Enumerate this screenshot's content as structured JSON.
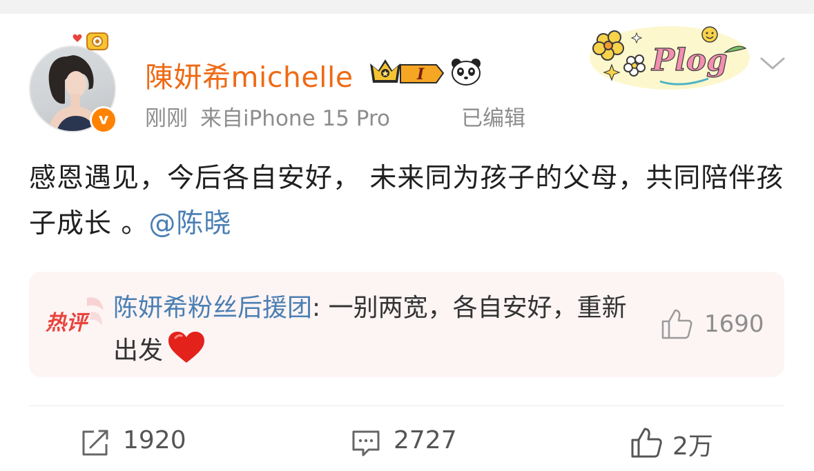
{
  "post": {
    "username": "陳妍希michelle",
    "time": "刚刚",
    "source": "来自iPhone 15 Pro",
    "edited": "已编辑",
    "badge_level": "I",
    "verified_mark": "v",
    "text": "感恩遇见，今后各自安好， 未来同为孩子的父母，共同陪伴孩子成长 。",
    "mention": "@陈晓",
    "decoration": "Plog"
  },
  "hot_comment": {
    "tag": "热评",
    "author": "陈妍希粉丝后援团",
    "text": ": 一别两宽，各自安好，重新出发",
    "likes": "1690"
  },
  "actions": {
    "repost_count": "1920",
    "comment_count": "2727",
    "like_count": "2万"
  },
  "colors": {
    "username": "#ee6a15",
    "link": "#4a7fb3",
    "verified": "#ff8200",
    "hot_bg": "#fdf4f4",
    "hot_tag": "#e8433c"
  },
  "icons": [
    "verified-icon",
    "crown-badge-icon",
    "panda-icon",
    "plog-sticker",
    "chevron-down-icon",
    "heart-icon",
    "thumbs-up-icon",
    "repost-icon",
    "comment-icon"
  ]
}
